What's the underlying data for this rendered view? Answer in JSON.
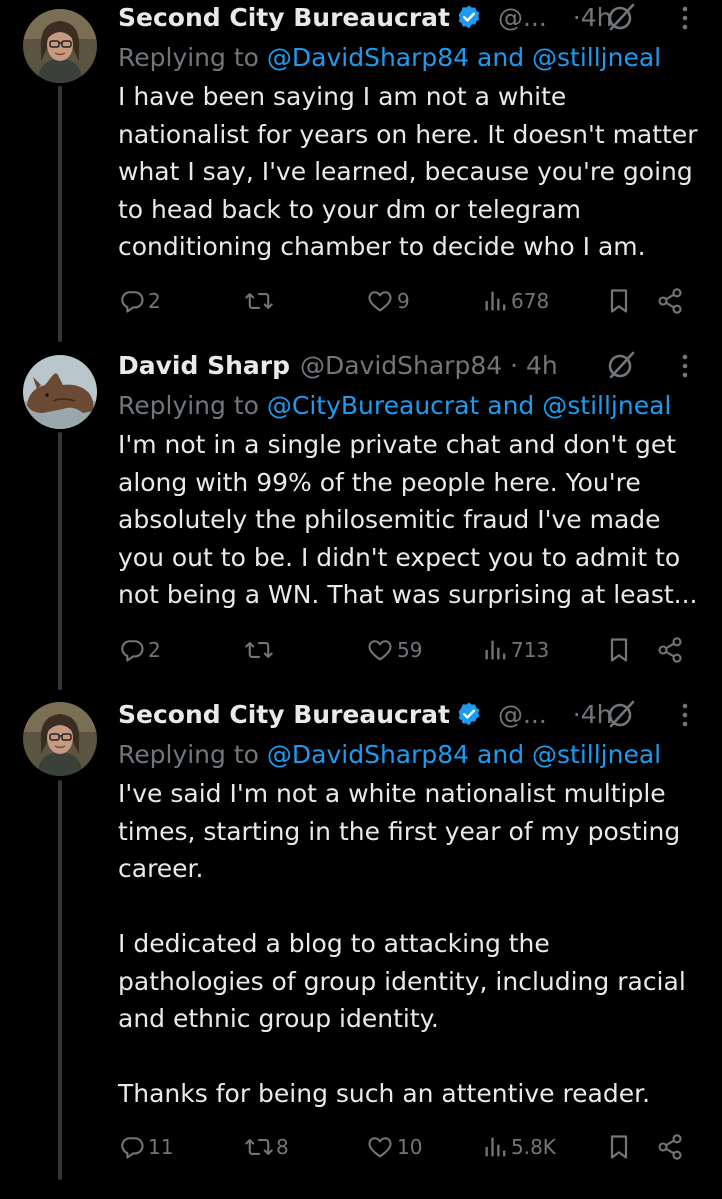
{
  "tweets": [
    {
      "author_name": "Second City Bureaucrat",
      "handle": "@...",
      "dot": "·",
      "time": "4h",
      "verified": true,
      "replying_prefix": "Replying to ",
      "reply_to_1": "@DavidSharp84",
      "reply_join": " and ",
      "reply_to_2": "@stilljneal",
      "paragraphs": [
        "I have been saying I am not a white nationalist for years on here. It doesn't matter what I say, I've learned, because you're going to head back to your dm or telegram conditioning chamber to decide who I am."
      ],
      "replies": "2",
      "reposts": "",
      "likes": "9",
      "views": "678"
    },
    {
      "author_name": "David Sharp",
      "handle": "@DavidSharp84",
      "dot": "·",
      "time": "4h",
      "verified": false,
      "replying_prefix": "Replying to ",
      "reply_to_1": "@CityBureaucrat",
      "reply_join": " and ",
      "reply_to_2": "@stilljneal",
      "paragraphs": [
        "I'm not in a single private chat and don't get along with 99% of the people here. You're absolutely the philosemitic fraud I've made you out to be. I didn't expect you to admit to not being a WN. That was surprising at least..."
      ],
      "replies": "2",
      "reposts": "",
      "likes": "59",
      "views": "713"
    },
    {
      "author_name": "Second City Bureaucrat",
      "handle": "@...",
      "dot": "·",
      "time": "4h",
      "verified": true,
      "replying_prefix": "Replying to ",
      "reply_to_1": "@DavidSharp84",
      "reply_join": " and ",
      "reply_to_2": "@stilljneal",
      "paragraphs": [
        "I've said I'm not a white nationalist multiple times, starting in the first year of my posting career.",
        "I dedicated a blog to attacking the pathologies of group identity, including racial and ethnic group identity.",
        "Thanks for being such an attentive reader."
      ],
      "replies": "11",
      "reposts": "8",
      "likes": "10",
      "views": "5.8K"
    }
  ],
  "icons": {
    "reply": "reply-icon",
    "repost": "repost-icon",
    "like": "heart-icon",
    "views": "views-icon",
    "bookmark": "bookmark-icon",
    "share": "share-icon",
    "grok": "grok-icon",
    "more": "more-icon",
    "verified": "verified-badge-icon"
  },
  "colors": {
    "background": "#000000",
    "text": "#e7e9ea",
    "muted": "#71767b",
    "link": "#1d9bf0",
    "thread_line": "#333639"
  }
}
